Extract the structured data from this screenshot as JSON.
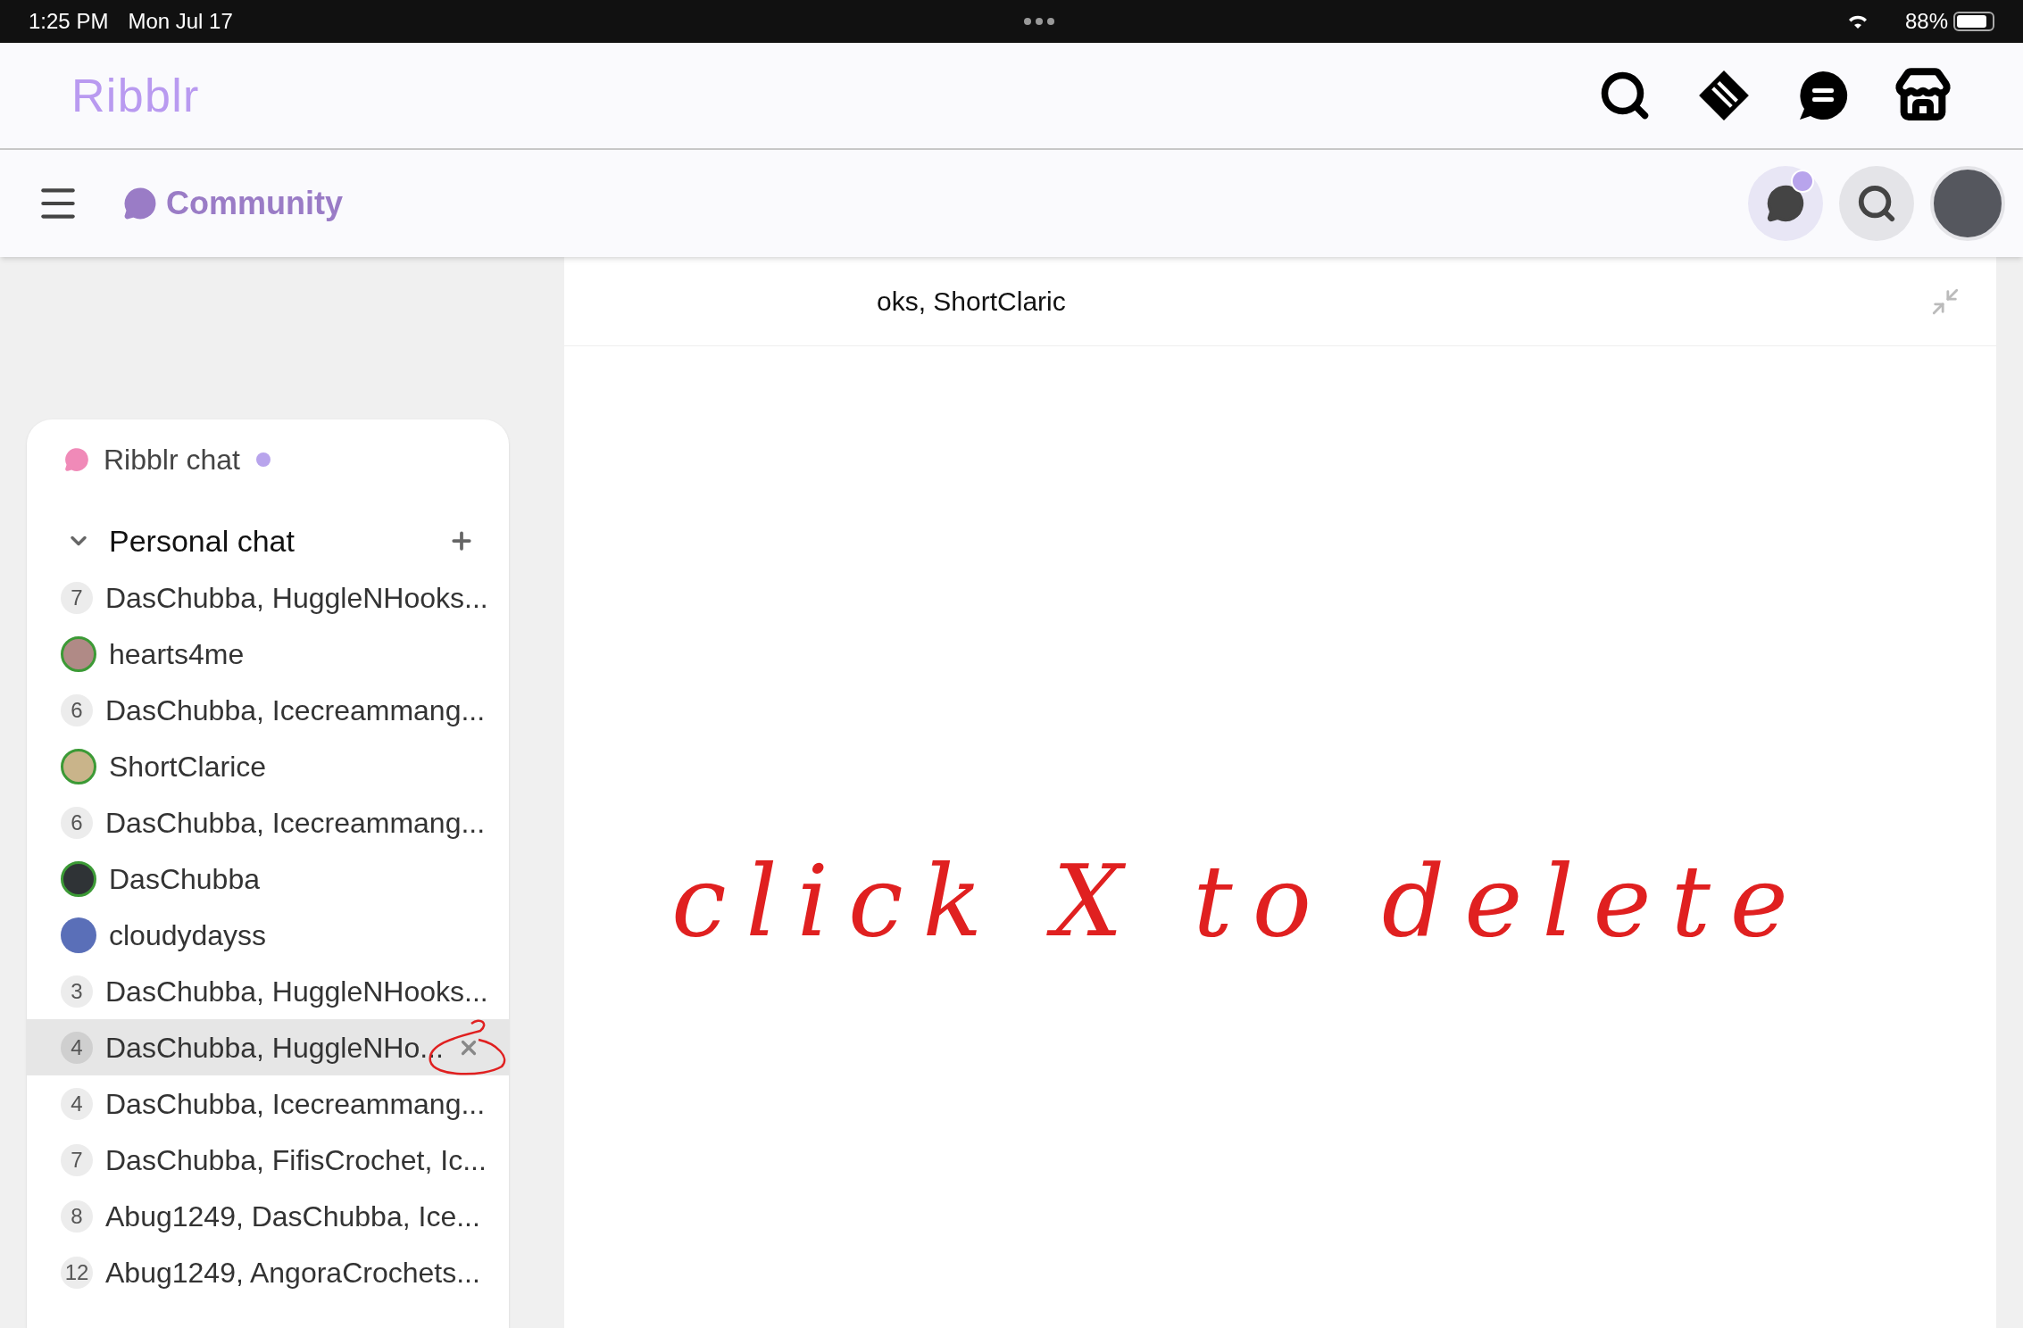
{
  "status_bar": {
    "time": "1:25 PM",
    "date": "Mon Jul 17",
    "battery": "88%"
  },
  "header": {
    "logo": "Ribblr"
  },
  "subheader": {
    "title": "Community",
    "chat_unread": true
  },
  "sidebar": {
    "ribblr_chat": {
      "label": "Ribblr chat",
      "unread": true
    },
    "personal_chat": {
      "label": "Personal chat",
      "expanded": true
    },
    "chats": [
      {
        "kind": "count",
        "count": "7",
        "name": "DasChubba, HuggleNHooks...",
        "selected": false
      },
      {
        "kind": "avatar",
        "name": "hearts4me",
        "online": true,
        "color": "#b08a86",
        "selected": false
      },
      {
        "kind": "count",
        "count": "6",
        "name": "DasChubba, Icecreammang...",
        "selected": false
      },
      {
        "kind": "avatar",
        "name": "ShortClarice",
        "online": true,
        "color": "#c9b48a",
        "selected": false
      },
      {
        "kind": "count",
        "count": "6",
        "name": "DasChubba, Icecreammang...",
        "selected": false
      },
      {
        "kind": "avatar",
        "name": "DasChubba",
        "online": true,
        "color": "#2f3336",
        "selected": false
      },
      {
        "kind": "avatar",
        "name": "cloudydayss",
        "online": false,
        "color": "#5a6fb8",
        "selected": false
      },
      {
        "kind": "count",
        "count": "3",
        "name": "DasChubba, HuggleNHooks...",
        "selected": false
      },
      {
        "kind": "count",
        "count": "4",
        "name": "DasChubba, HuggleNHo...",
        "selected": true
      },
      {
        "kind": "count",
        "count": "4",
        "name": "DasChubba, Icecreammang...",
        "selected": false
      },
      {
        "kind": "count",
        "count": "7",
        "name": "DasChubba, FifisCrochet, Ic...",
        "selected": false
      },
      {
        "kind": "count",
        "count": "8",
        "name": "Abug1249, DasChubba, Ice...",
        "selected": false
      },
      {
        "kind": "count",
        "count": "12",
        "name": "Abug1249, AngoraCrochets...",
        "selected": false
      }
    ]
  },
  "chat_panel": {
    "title": "oks, ShortClaric"
  },
  "annotation": {
    "text": "click X to delete"
  }
}
